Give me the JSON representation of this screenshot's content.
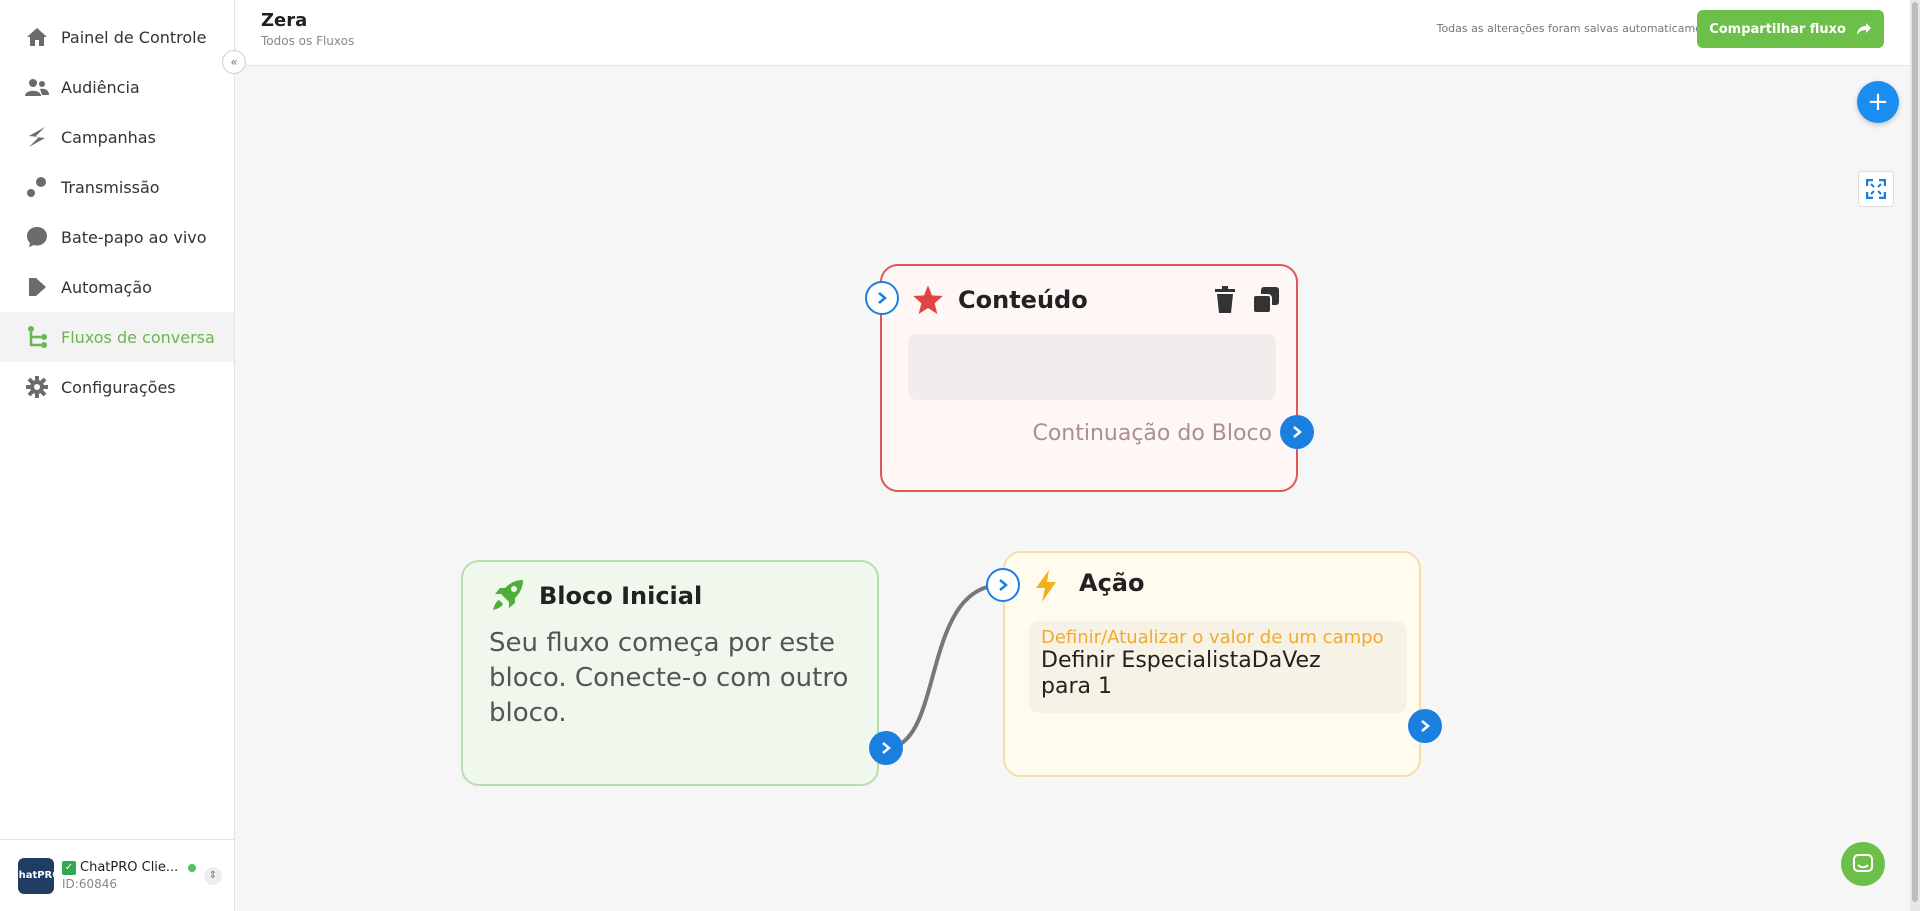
{
  "sidebar": {
    "items": [
      {
        "label": "Painel de Controle",
        "icon": "home-icon"
      },
      {
        "label": "Audiência",
        "icon": "users-icon"
      },
      {
        "label": "Campanhas",
        "icon": "campaign-icon"
      },
      {
        "label": "Transmissão",
        "icon": "broadcast-icon"
      },
      {
        "label": "Bate-papo ao vivo",
        "icon": "chat-bubble-icon"
      },
      {
        "label": "Automação",
        "icon": "automation-icon"
      },
      {
        "label": "Fluxos de conversa",
        "icon": "flow-icon",
        "active": true
      },
      {
        "label": "Configurações",
        "icon": "gear-icon"
      }
    ],
    "account": {
      "name": "ChatPRO Clie...",
      "id_text": "ID:60846",
      "logo_text": "ChatPRO"
    }
  },
  "header": {
    "title": "Zera",
    "breadcrumb": "Todos os Fluxos",
    "autosave": "Todas as alterações foram salvas automaticamente",
    "share_label": "Compartilhar fluxo"
  },
  "blocks": {
    "content": {
      "title": "Conteúdo",
      "continuation": "Continuação do Bloco"
    },
    "start": {
      "title": "Bloco Inicial",
      "description": "Seu fluxo começa por este bloco. Conecte-o com outro bloco."
    },
    "action": {
      "title": "Ação",
      "action_type": "Definir/Atualizar o valor de um campo",
      "action_line1": "Definir EspecialistaDaVez",
      "action_line2": "para 1"
    }
  },
  "colors": {
    "accent_green": "#6cc04a",
    "port_blue": "#1b7fe0",
    "content_border": "#e05555",
    "start_border": "#b7dfac",
    "action_border": "#f6deaa",
    "action_label": "#f2a92e"
  }
}
